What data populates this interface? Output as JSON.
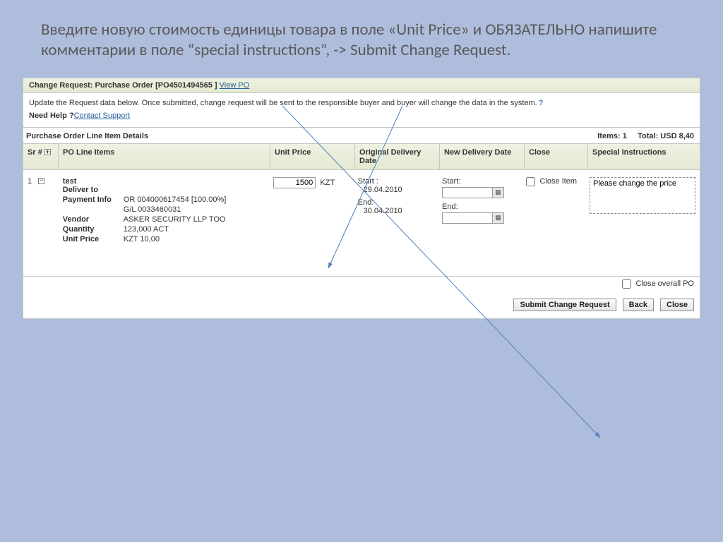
{
  "instruction": "Введите новую стоимость единицы товара в поле «Unit Price»  и   ОБЯЗАТЕЛЬНО напишите комментарии в поле “special instructions”, -> Submit Change Request.",
  "header": {
    "title_prefix": "Change Request: Purchase Order [",
    "po_number": "PO4501494565",
    "title_suffix": " ] ",
    "view_po_link": "View PO"
  },
  "info": {
    "text": "Update the Request data below. Once submitted, change request will be sent to the responsible  buyer and buyer will change the data in the system.",
    "need_help_label": "Need Help ?",
    "contact_link": "Contact Support"
  },
  "section": {
    "title": "Purchase Order Line Item Details",
    "items_label": "Items:",
    "items_count": "1",
    "total_label": "Total:",
    "total_value": "USD 8,40"
  },
  "columns": {
    "sr": "Sr #",
    "po_line": "PO Line Items",
    "unit_price": "Unit Price",
    "orig_date": "Original Delivery Date",
    "new_date": "New  Delivery Date",
    "close": "Close",
    "special": "Special Instructions"
  },
  "row": {
    "sr": "1",
    "item_name": "test",
    "deliver_to_label": "Deliver to",
    "payment_info_label": "Payment Info",
    "payment_info_1": "OR 004000617454 [100.00%]",
    "payment_info_2": "G/L 0033460031",
    "vendor_label": "Vendor",
    "vendor_value": "ASKER SECURITY LLP TOO",
    "quantity_label": "Quantity",
    "quantity_value": "123,000 ACT",
    "unit_price_label": "Unit Price",
    "unit_price_value_label": "KZT 10,00",
    "price_input_value": "1500",
    "currency": "KZT",
    "orig_start_label": "Start :",
    "orig_start_value": "29.04.2010",
    "orig_end_label": "End:",
    "orig_end_value": "30.04.2010",
    "new_start_label": "Start:",
    "new_end_label": "End:",
    "close_item_label": "Close Item",
    "special_value": "Please change the price"
  },
  "footer": {
    "close_overall": "Close overall PO",
    "submit": "Submit Change Request",
    "back": "Back",
    "close": "Close"
  }
}
